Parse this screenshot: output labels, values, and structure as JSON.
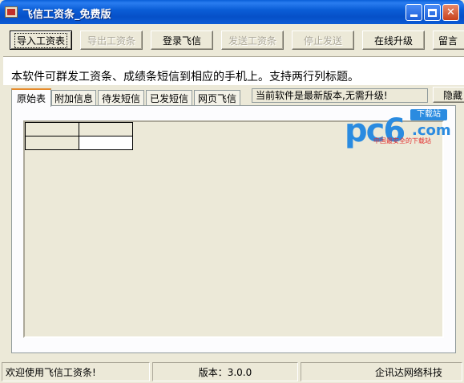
{
  "window": {
    "title": "飞信工资条_免费版"
  },
  "toolbar": {
    "buttons": [
      {
        "label": "导入工资表",
        "enabled": true
      },
      {
        "label": "导出工资条",
        "enabled": false
      },
      {
        "label": "登录飞信",
        "enabled": true
      },
      {
        "label": "发送工资条",
        "enabled": false
      },
      {
        "label": "停止发送",
        "enabled": false
      },
      {
        "label": "在线升级",
        "enabled": true
      },
      {
        "label": "留言",
        "enabled": true
      }
    ]
  },
  "banner": {
    "text": "本软件可群发工资条、成绩条短信到相应的手机上。支持两行列标题。"
  },
  "tabs": [
    "原始表",
    "附加信息",
    "待发短信",
    "已发短信",
    "网页飞信"
  ],
  "update_status": "当前软件是最新版本,无需升级!",
  "hide_button": "隐藏",
  "watermark": {
    "brand": "pc6",
    "domain": ".com",
    "badge": "下载站",
    "slogan": "中国最安全的下载站"
  },
  "statusbar": {
    "welcome": "欢迎使用飞信工资条!",
    "version": "版本：3.0.0",
    "company": "企讯达网络科技"
  }
}
